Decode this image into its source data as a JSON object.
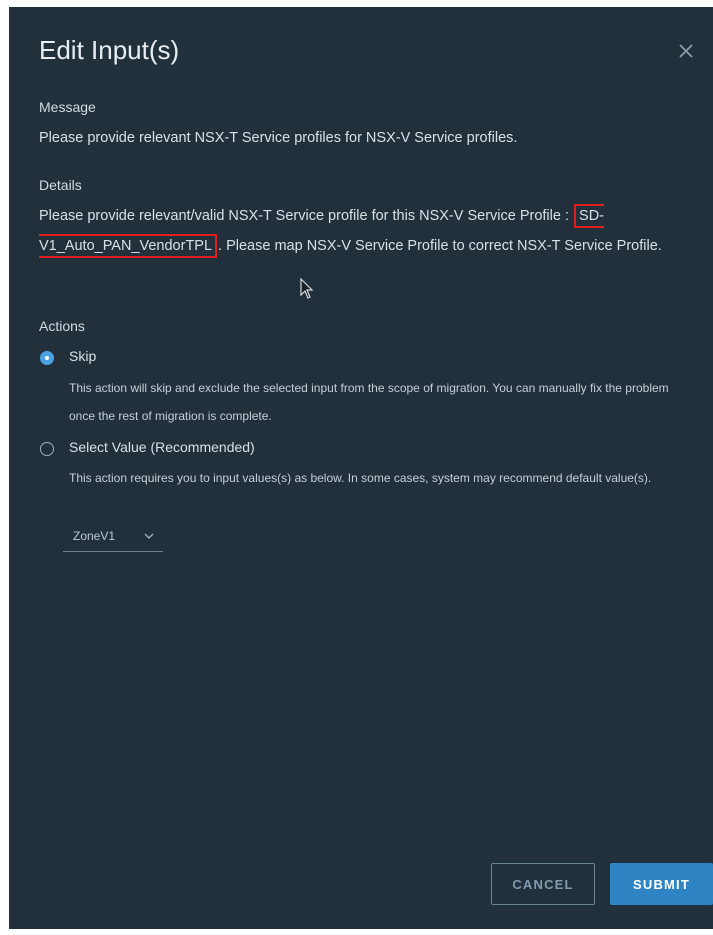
{
  "dialog": {
    "title": "Edit Input(s)",
    "close_icon": "close-icon"
  },
  "message": {
    "label": "Message",
    "text": "Please provide relevant NSX-T Service profiles for NSX-V Service profiles."
  },
  "details": {
    "label": "Details",
    "text_before": "Please provide relevant/valid NSX-T Service profile for this NSX-V Service Profile : ",
    "highlight": "SD-V1_Auto_PAN_VendorTPL",
    "text_after": ". Please map NSX-V Service Profile to correct NSX-T Service Profile."
  },
  "actions": {
    "label": "Actions",
    "options": [
      {
        "label": "Skip",
        "selected": true,
        "help": "This action will skip and exclude the selected input from the scope of migration. You can manually fix the problem once the rest of migration is complete."
      },
      {
        "label": "Select Value (Recommended)",
        "selected": false,
        "help": "This action requires you to input values(s) as below. In some cases, system may recommend default value(s)."
      }
    ],
    "select_value": "ZoneV1"
  },
  "buttons": {
    "cancel": "CANCEL",
    "submit": "SUBMIT"
  },
  "colors": {
    "background": "#22303b",
    "accent": "#2f84c4",
    "highlight_border": "#e02020"
  }
}
